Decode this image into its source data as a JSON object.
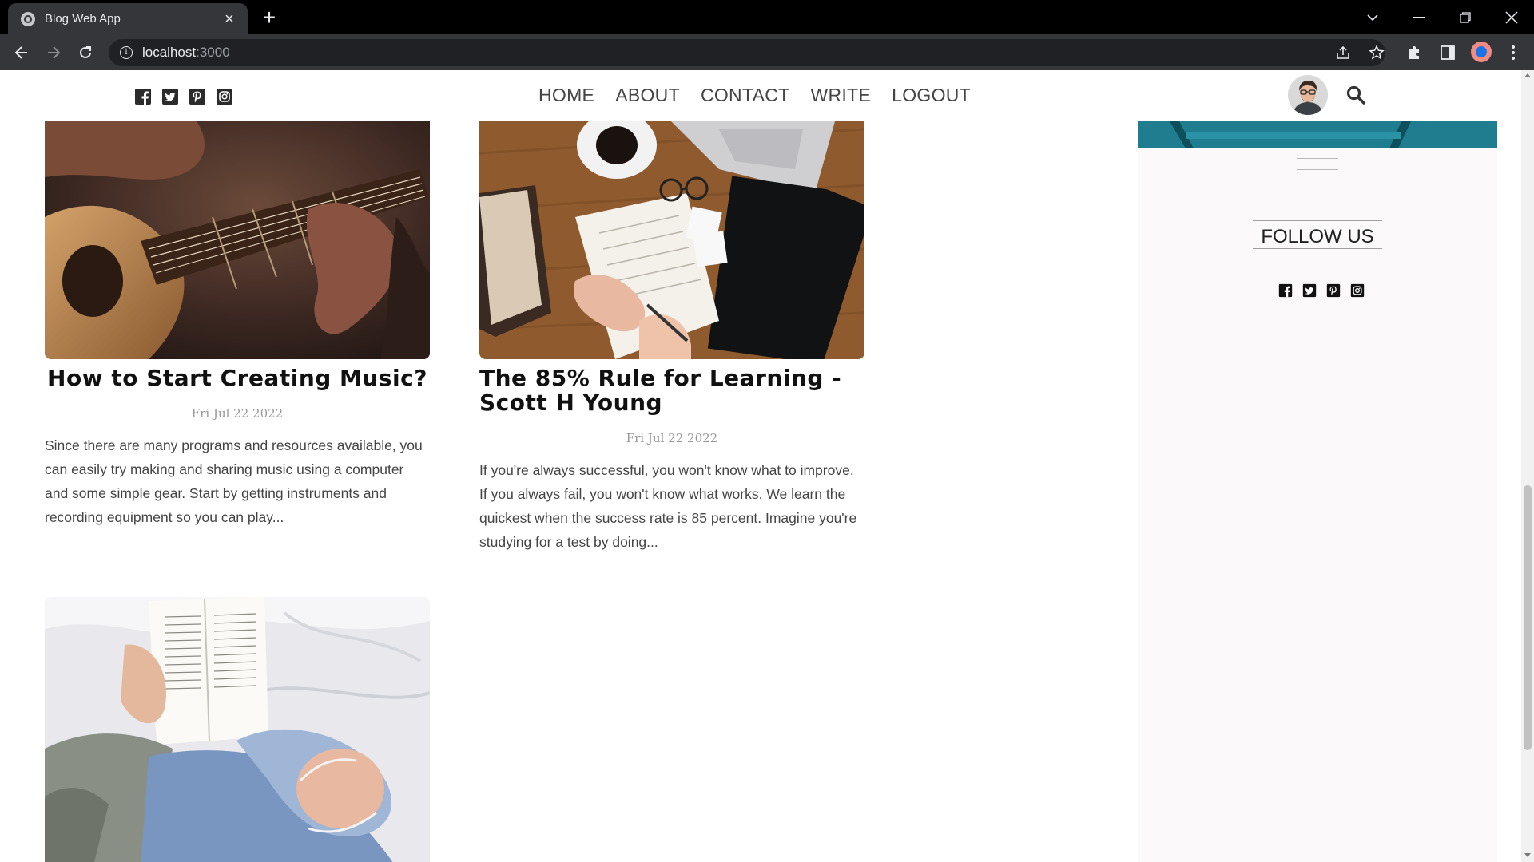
{
  "browser": {
    "tab_title": "Blog Web App",
    "tab_close": "×",
    "new_tab": "+",
    "url_host": "localhost",
    "url_port": ":3000"
  },
  "nav": {
    "social": [
      "facebook-icon",
      "twitter-icon",
      "pinterest-icon",
      "instagram-icon"
    ],
    "menu": [
      "HOME",
      "ABOUT",
      "CONTACT",
      "WRITE",
      "LOGOUT"
    ]
  },
  "posts": [
    {
      "title": "How to Start Creating Music?",
      "date": "Fri Jul 22 2022",
      "excerpt": "Since there are many programs and resources available, you can easily try making and sharing music using a computer and some simple gear. Start by getting instruments and recording equipment so you can play..."
    },
    {
      "title": "The 85% Rule for Learning - Scott H Young",
      "date": "Fri Jul 22 2022",
      "excerpt": "If you're always successful, you won't know what to improve. If you always fail, you won't know what works. We learn the quickest when the success rate is 85 percent. Imagine you're studying for a test by doing..."
    }
  ],
  "sidebar": {
    "follow_title": "FOLLOW US"
  },
  "colors": {
    "chrome_dark": "#000000",
    "toolbar": "#35363a",
    "sidebar_bg": "#fbf9fa",
    "sidebar_image": "#1f7a8c"
  }
}
